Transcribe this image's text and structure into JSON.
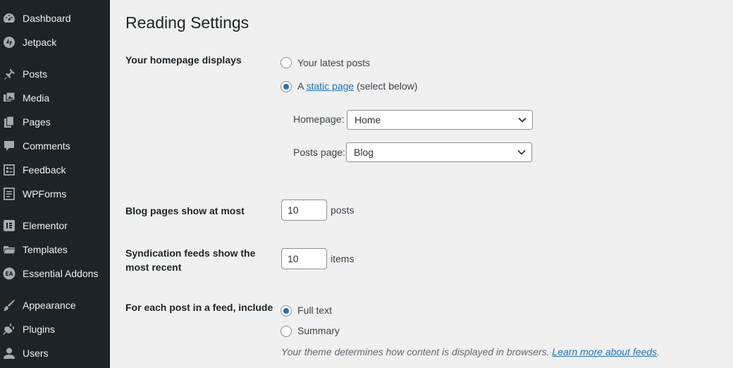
{
  "sidebar": {
    "items": [
      {
        "label": "Dashboard",
        "icon": "dashboard-icon"
      },
      {
        "label": "Jetpack",
        "icon": "jetpack-icon"
      },
      {
        "label": "Posts",
        "icon": "pushpin-icon"
      },
      {
        "label": "Media",
        "icon": "media-icon"
      },
      {
        "label": "Pages",
        "icon": "pages-icon"
      },
      {
        "label": "Comments",
        "icon": "comment-icon"
      },
      {
        "label": "Feedback",
        "icon": "feedback-icon"
      },
      {
        "label": "WPForms",
        "icon": "wpforms-icon"
      },
      {
        "label": "Elementor",
        "icon": "elementor-icon"
      },
      {
        "label": "Templates",
        "icon": "folder-icon"
      },
      {
        "label": "Essential Addons",
        "icon": "essential-addons-icon"
      },
      {
        "label": "Appearance",
        "icon": "paintbrush-icon"
      },
      {
        "label": "Plugins",
        "icon": "plugin-icon"
      },
      {
        "label": "Users",
        "icon": "user-icon"
      }
    ]
  },
  "page": {
    "title": "Reading Settings"
  },
  "homepage_displays": {
    "label": "Your homepage displays",
    "option_latest": "Your latest posts",
    "option_static_prefix": "A",
    "option_static_link": "static page",
    "option_static_suffix": "(select below)",
    "selected": "static page",
    "homepage_label": "Homepage:",
    "homepage_value": "Home",
    "posts_page_label": "Posts page:",
    "posts_page_value": "Blog"
  },
  "blog_pages": {
    "label": "Blog pages show at most",
    "value": "10",
    "unit": "posts"
  },
  "syndication": {
    "label_line1": "Syndication feeds show the",
    "label_line2": "most recent",
    "value": "10",
    "unit": "items"
  },
  "feed_include": {
    "label": "For each post in a feed, include",
    "option_full": "Full text",
    "option_summary": "Summary",
    "selected": "Full text",
    "description": "Your theme determines how content is displayed in browsers.",
    "description_link": "Learn more about feeds",
    "description_end": "."
  },
  "colors": {
    "sidebar_bg": "#1d2327",
    "accent": "#2271b1",
    "page_bg": "#f0f0f1"
  }
}
